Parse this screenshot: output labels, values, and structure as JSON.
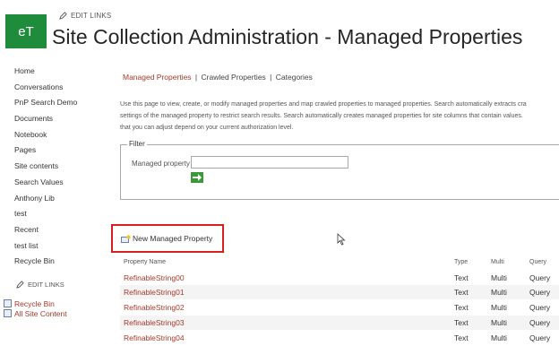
{
  "header": {
    "logo_text": "eT",
    "edit_links": "EDIT LINKS",
    "title": "Site Collection Administration - Managed Properties",
    "brand_color": "#1e8c3a"
  },
  "nav": {
    "items": [
      "Home",
      "Conversations",
      "PnP Search Demo",
      "Documents",
      "Notebook",
      "Pages",
      "Site contents",
      "Search Values",
      "Anthony Lib",
      "test",
      "Recent",
      "test list",
      "Recycle Bin"
    ],
    "edit_links": "EDIT LINKS",
    "quick_links": [
      "Recycle Bin",
      "All Site Content"
    ]
  },
  "tabs": {
    "managed": "Managed Properties",
    "crawled": "Crawled Properties",
    "categories": "Categories",
    "separator": "|"
  },
  "description": {
    "line1": "Use this page to view, create, or modify managed properties and map crawled properties to managed properties. Search automatically extracts cra",
    "line2": "settings of the managed property to restrict search results. Search automatically creates managed properties for site columns that contain values.",
    "line3": "that you can adjust depend on your current authorization level."
  },
  "filter": {
    "legend": "Filter",
    "label": "Managed property",
    "value": ""
  },
  "new_property": "New Managed Property",
  "table": {
    "headers": [
      "Property Name",
      "Type",
      "Multi",
      "Query"
    ],
    "rows": [
      [
        "RefinableString00",
        "Text",
        "Multi",
        "Query"
      ],
      [
        "RefinableString01",
        "Text",
        "Multi",
        "Query"
      ],
      [
        "RefinableString02",
        "Text",
        "Multi",
        "Query"
      ],
      [
        "RefinableString03",
        "Text",
        "Multi",
        "Query"
      ],
      [
        "RefinableString04",
        "Text",
        "Multi",
        "Query"
      ]
    ]
  },
  "colors": {
    "link": "#a6392a",
    "highlight": "#d71f1f"
  }
}
